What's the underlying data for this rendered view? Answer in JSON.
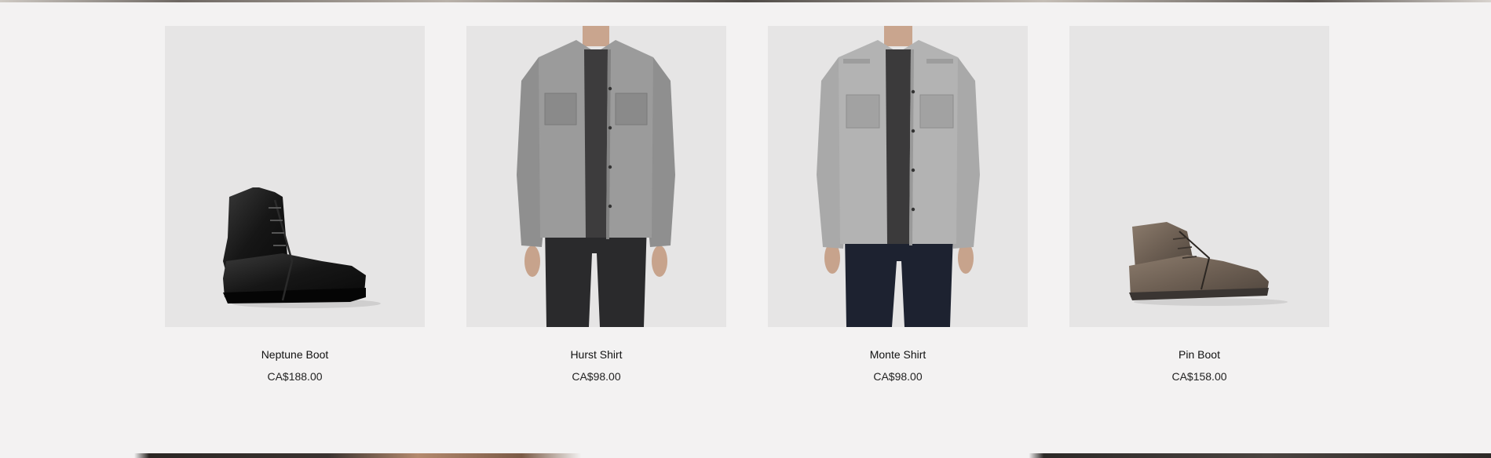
{
  "products": [
    {
      "name": "Neptune Boot",
      "price": "CA$188.00",
      "image": "black-leather-boot"
    },
    {
      "name": "Hurst Shirt",
      "price": "CA$98.00",
      "image": "grey-denim-shirt"
    },
    {
      "name": "Monte Shirt",
      "price": "CA$98.00",
      "image": "grey-denim-shirt-dark-jeans"
    },
    {
      "name": "Pin Boot",
      "price": "CA$158.00",
      "image": "brown-suede-boot"
    }
  ],
  "colors": {
    "page_background": "#f3f2f2",
    "tile_background": "#e6e5e5",
    "text": "#111111"
  }
}
